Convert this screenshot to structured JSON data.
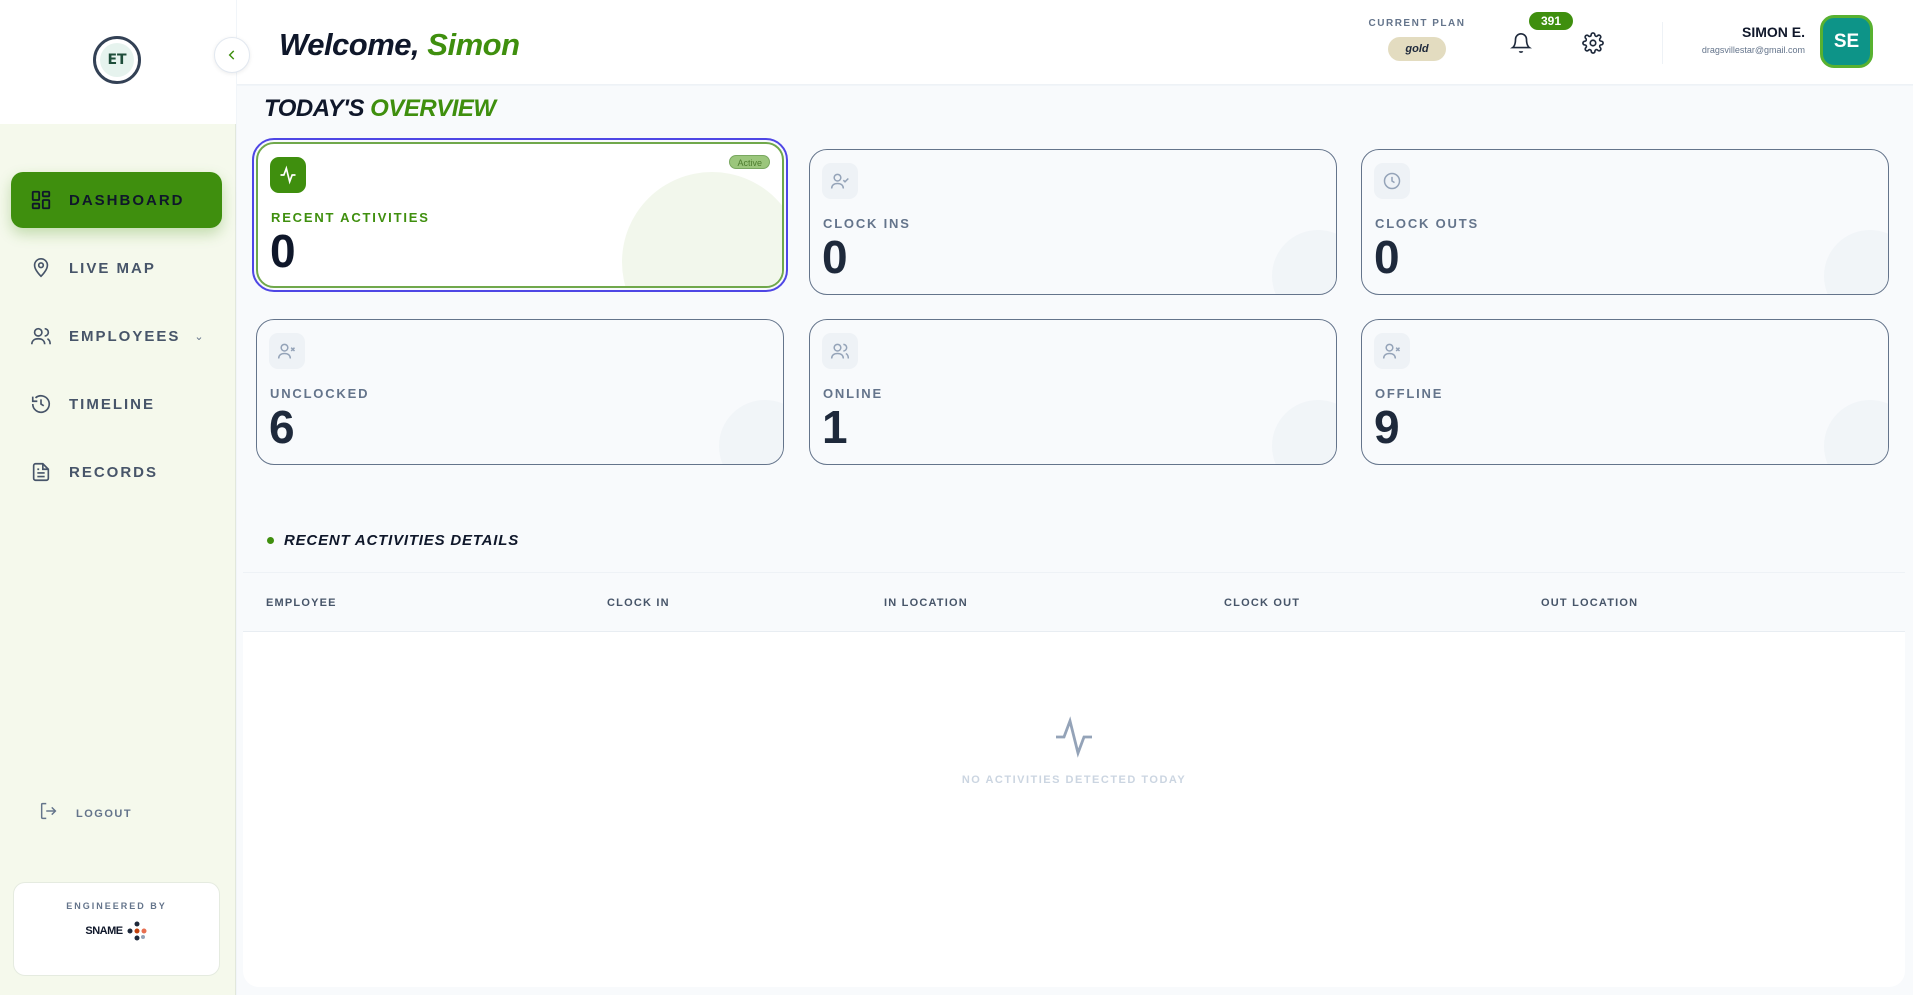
{
  "sidebar": {
    "logo_text": "ET",
    "nav": [
      {
        "label": "DASHBOARD",
        "icon": "dashboard-icon",
        "active": true
      },
      {
        "label": "LIVE MAP",
        "icon": "map-pin-icon"
      },
      {
        "label": "EMPLOYEES",
        "icon": "users-icon",
        "has_chevron": true
      },
      {
        "label": "TIMELINE",
        "icon": "history-icon"
      },
      {
        "label": "RECORDS",
        "icon": "document-icon"
      }
    ],
    "logout_label": "LOGOUT",
    "engineered_by": "ENGINEERED BY",
    "sname_logo": "SNAME"
  },
  "header": {
    "welcome_prefix": "Welcome,",
    "welcome_name": "Simon",
    "plan_label": "CURRENT PLAN",
    "plan_value": "gold",
    "notification_count": "391",
    "user_name": "SIMON E.",
    "user_email": "dragsvillestar@gmail.com",
    "avatar_initials": "SE"
  },
  "overview": {
    "title_prefix": "TODAY'S",
    "title_accent": "OVERVIEW",
    "cards": [
      {
        "label": "RECENT ACTIVITIES",
        "value": "0",
        "badge": "Active",
        "icon": "activity-icon"
      },
      {
        "label": "CLOCK INS",
        "value": "0",
        "icon": "user-check-icon"
      },
      {
        "label": "CLOCK OUTS",
        "value": "0",
        "icon": "clock-icon"
      },
      {
        "label": "UNCLOCKED",
        "value": "6",
        "icon": "user-x-icon"
      },
      {
        "label": "ONLINE",
        "value": "1",
        "icon": "users-icon"
      },
      {
        "label": "OFFLINE",
        "value": "9",
        "icon": "user-x-icon"
      }
    ]
  },
  "details": {
    "title": "RECENT ACTIVITIES DETAILS",
    "columns": [
      "EMPLOYEE",
      "CLOCK IN",
      "IN LOCATION",
      "CLOCK OUT",
      "OUT LOCATION"
    ],
    "empty_text": "NO ACTIVITIES DETECTED TODAY"
  },
  "colors": {
    "accent": "#3f8f0e",
    "avatar": "#0d9488",
    "sidebar_bg": "#f5f9ec"
  }
}
